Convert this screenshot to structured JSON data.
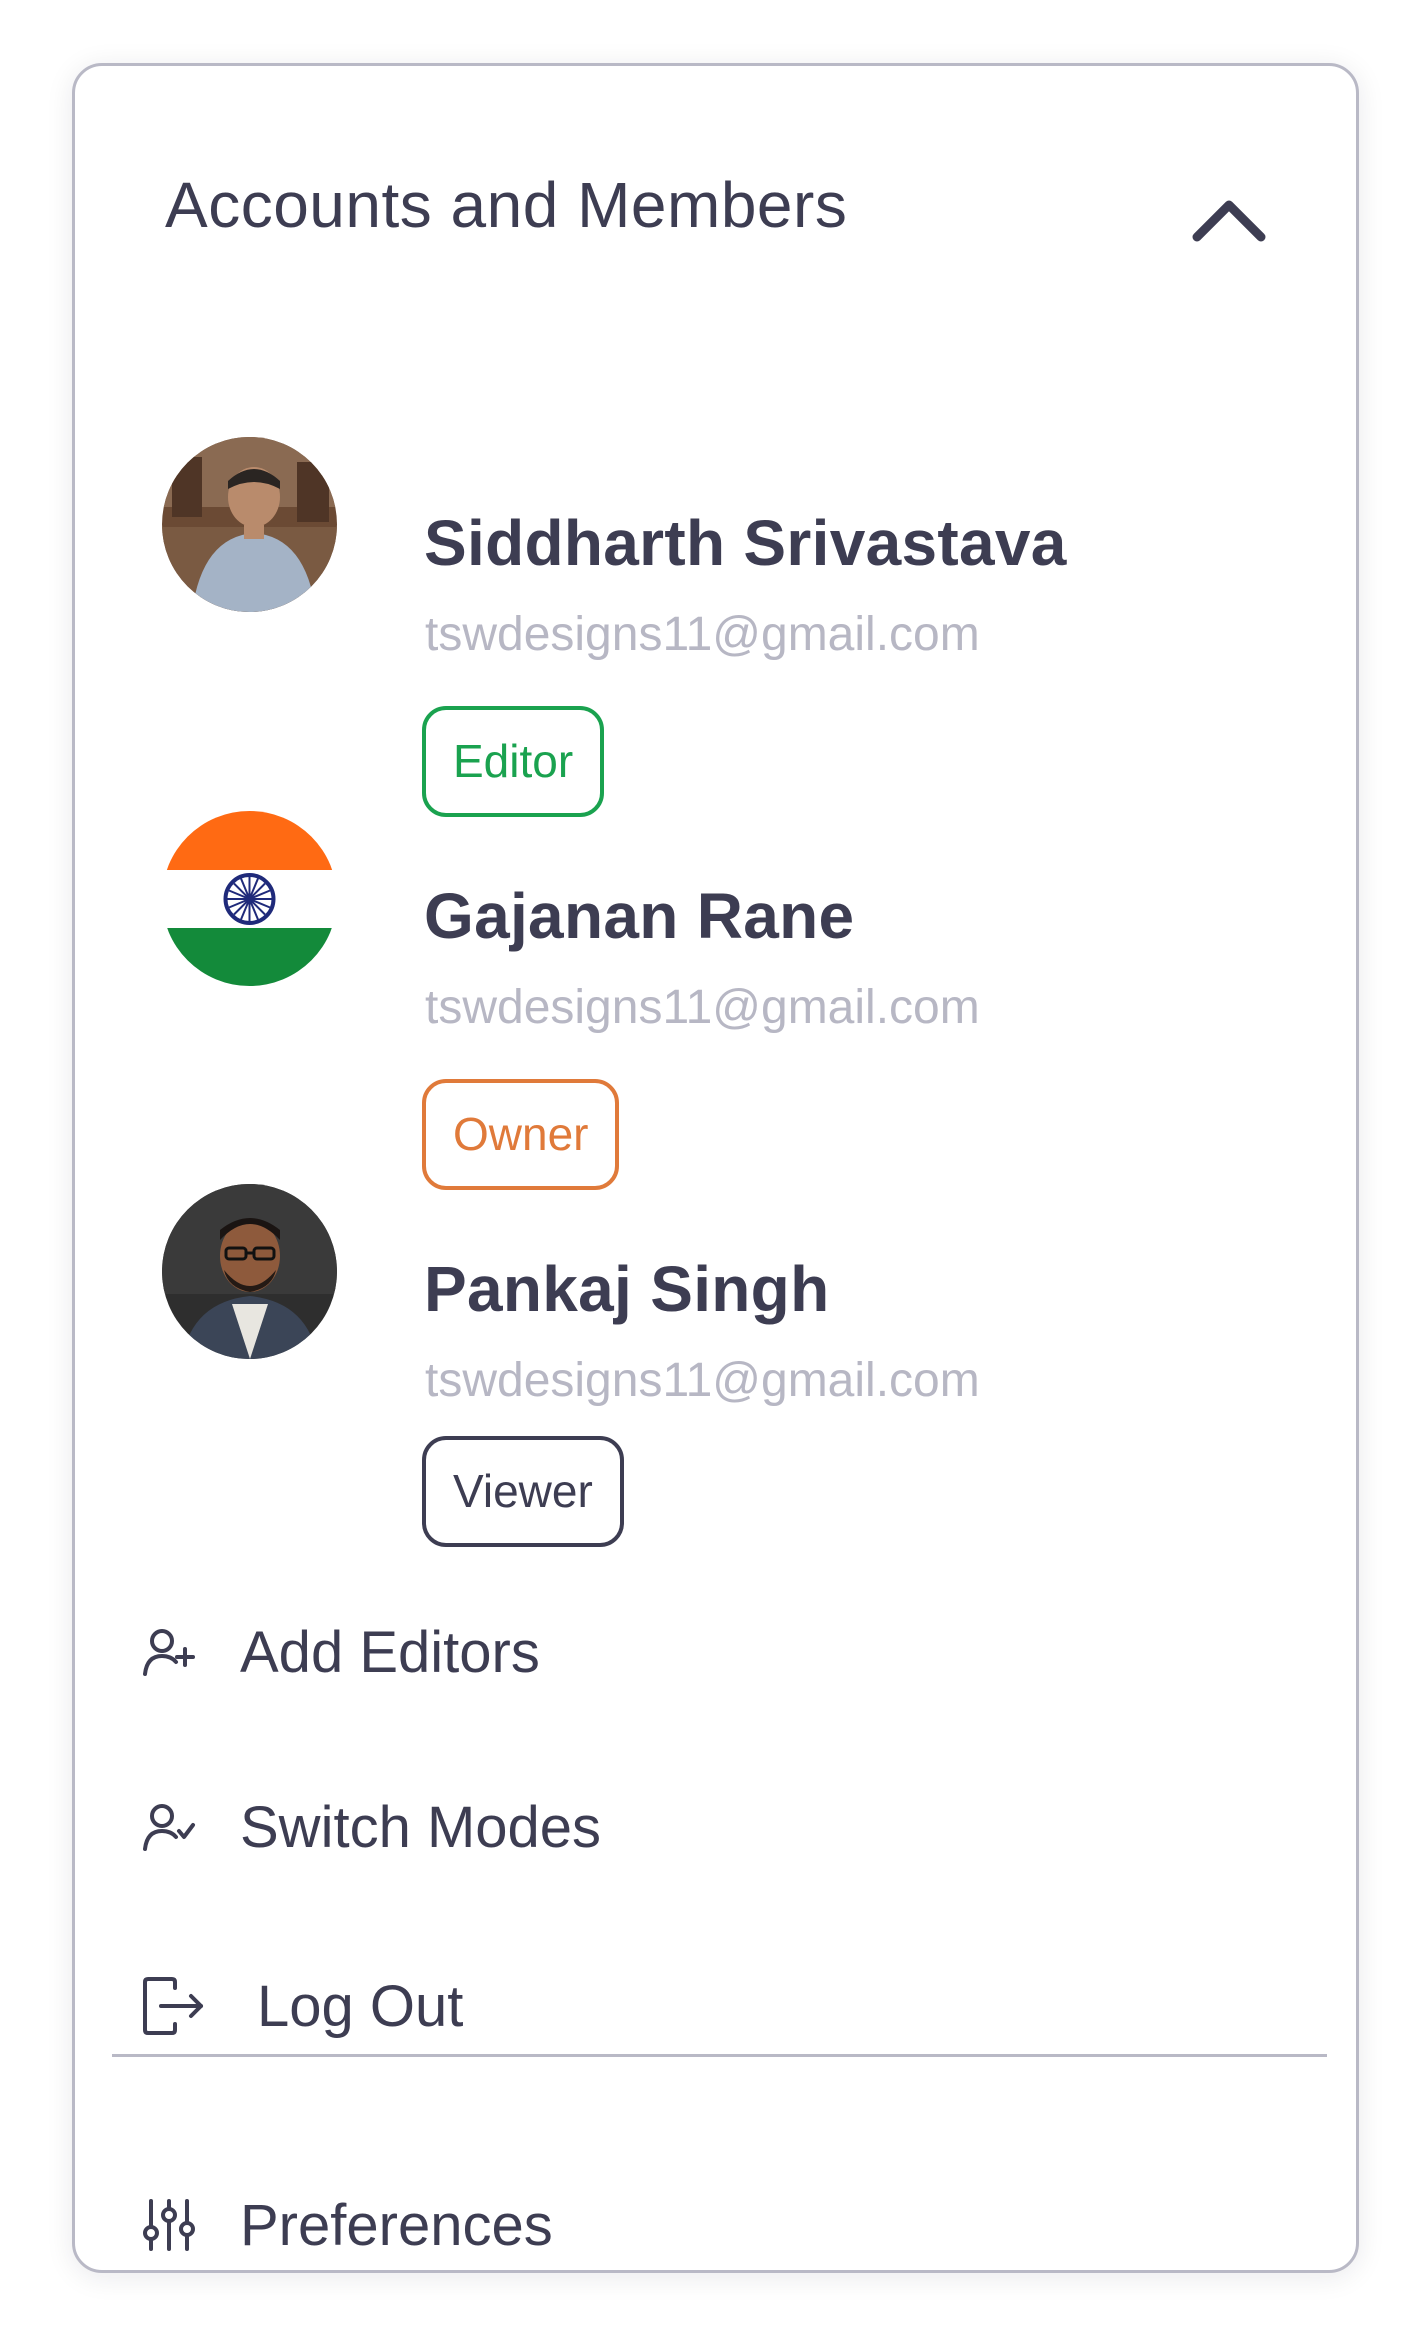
{
  "panel": {
    "title": "Accounts and Members",
    "collapse_icon": "chevron-up-icon"
  },
  "members": [
    {
      "name": "Siddharth Srivastava",
      "email": "tswdesigns11@gmail.com",
      "role": "Editor",
      "role_color": "#1aa24f",
      "avatar": "photo"
    },
    {
      "name": "Gajanan Rane",
      "email": "tswdesigns11@gmail.com",
      "role": "Owner",
      "role_color": "#e07a3a",
      "avatar": "indian-flag"
    },
    {
      "name": "Pankaj Singh",
      "email": "tswdesigns11@gmail.com",
      "role": "Viewer",
      "role_color": "#3d3d52",
      "avatar": "photo"
    }
  ],
  "menu": {
    "add_editors": {
      "label": "Add Editors",
      "icon": "user-plus-icon"
    },
    "switch_modes": {
      "label": "Switch Modes",
      "icon": "user-check-icon"
    },
    "log_out": {
      "label": "Log Out",
      "icon": "logout-icon"
    },
    "preferences": {
      "label": "Preferences",
      "icon": "sliders-icon"
    }
  },
  "colors": {
    "text_primary": "#3d3d52",
    "text_muted": "#b7b7c4",
    "border": "#b9b9c6"
  }
}
